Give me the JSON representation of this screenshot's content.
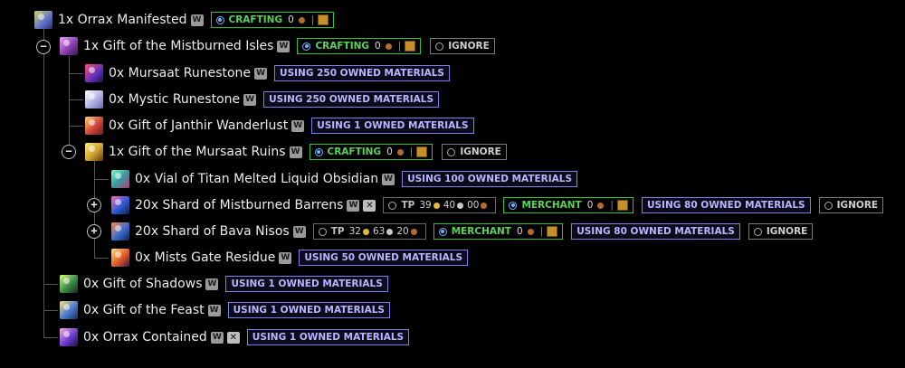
{
  "rows": [
    {
      "label": "1x Orrax Manifested",
      "badges": {
        "craft": "CRAFTING",
        "craft_amt": "0"
      }
    },
    {
      "label": "1x Gift of the Mistburned Isles",
      "badges": {
        "craft": "CRAFTING",
        "craft_amt": "0",
        "ignore": "IGNORE"
      }
    },
    {
      "label": "0x Mursaat Runestone",
      "badges": {
        "owned": "USING 250 OWNED MATERIALS"
      }
    },
    {
      "label": "0x Mystic Runestone",
      "badges": {
        "owned": "USING 250 OWNED MATERIALS"
      }
    },
    {
      "label": "0x Gift of Janthir Wanderlust",
      "badges": {
        "owned": "USING 1 OWNED MATERIALS"
      }
    },
    {
      "label": "1x Gift of the Mursaat Ruins",
      "badges": {
        "craft": "CRAFTING",
        "craft_amt": "0",
        "ignore": "IGNORE"
      }
    },
    {
      "label": "0x Vial of Titan Melted Liquid Obsidian",
      "badges": {
        "owned": "USING 100 OWNED MATERIALS"
      }
    },
    {
      "label": "20x Shard of Mistburned Barrens",
      "badges": {
        "tp": "TP",
        "tp_g": "39",
        "tp_s": "40",
        "tp_c": "00",
        "merchant": "MERCHANT",
        "merchant_amt": "0",
        "owned": "USING 80 OWNED MATERIALS",
        "ignore": "IGNORE"
      }
    },
    {
      "label": "20x Shard of Bava Nisos",
      "badges": {
        "tp": "TP",
        "tp_g": "32",
        "tp_s": "63",
        "tp_c": "20",
        "merchant": "MERCHANT",
        "merchant_amt": "0",
        "owned": "USING 80 OWNED MATERIALS",
        "ignore": "IGNORE"
      }
    },
    {
      "label": "0x Mists Gate Residue",
      "badges": {
        "owned": "USING 50 OWNED MATERIALS"
      }
    },
    {
      "label": "0x Gift of Shadows",
      "badges": {
        "owned": "USING 1 OWNED MATERIALS"
      }
    },
    {
      "label": "0x Gift of the Feast",
      "badges": {
        "owned": "USING 1 OWNED MATERIALS"
      }
    },
    {
      "label": "0x Orrax Contained",
      "badges": {
        "owned": "USING 1 OWNED MATERIALS"
      }
    }
  ],
  "toggles": {
    "collapse": "−",
    "expand": "+"
  },
  "wiki_glyph": "W",
  "exchange_glyph": "✕",
  "icons": [
    "orrax-manifested-icon",
    "gift-mistburned-isles-icon",
    "mursaat-runestone-icon",
    "mystic-runestone-icon",
    "gift-janthir-wanderlust-icon",
    "gift-mursaat-ruins-icon",
    "vial-obsidian-icon",
    "shard-mistburned-barrens-icon",
    "shard-bava-nisos-icon",
    "mists-gate-residue-icon",
    "gift-of-shadows-icon",
    "gift-of-the-feast-icon",
    "orrax-contained-icon"
  ],
  "colors": {
    "background": "#000000",
    "crafting_border": "#34c134",
    "owned_border": "#7f7fe8",
    "ignore_border": "#7a7a7a",
    "tree_line": "#555555"
  }
}
